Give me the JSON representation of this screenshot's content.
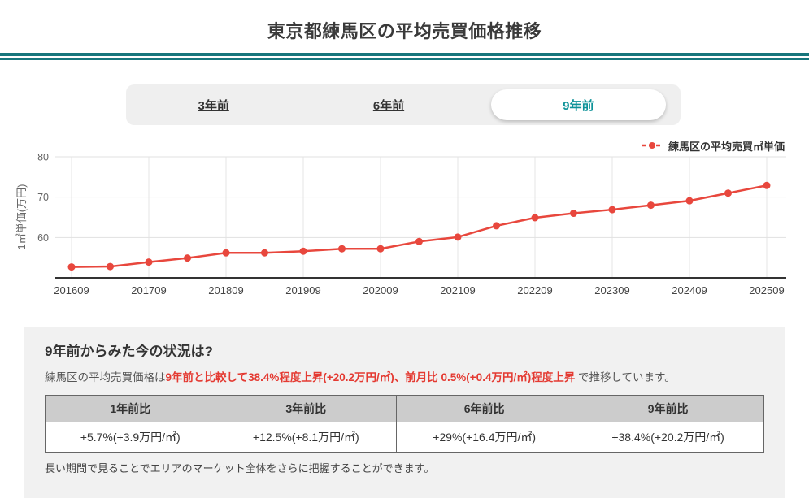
{
  "page": {
    "title": "東京都練馬区の平均売買価格推移"
  },
  "tabs": {
    "items": [
      {
        "label": "3年前",
        "active": false
      },
      {
        "label": "6年前",
        "active": false
      },
      {
        "label": "9年前",
        "active": true
      }
    ]
  },
  "legend": {
    "label": "練馬区の平均売買㎡単価"
  },
  "chart_data": {
    "type": "line",
    "title": "",
    "xlabel": "",
    "ylabel": "1㎡単価(万円)",
    "ylim": [
      50,
      80
    ],
    "yticks": [
      60,
      70,
      80
    ],
    "tick_every": 2,
    "grid": true,
    "legend_position": "top-right",
    "x": [
      "201609",
      "201703",
      "201709",
      "201803",
      "201809",
      "201903",
      "201909",
      "202003",
      "202009",
      "202103",
      "202109",
      "202203",
      "202209",
      "202303",
      "202309",
      "202403",
      "202409",
      "202503",
      "202509"
    ],
    "series": [
      {
        "name": "練馬区の平均売買㎡単価",
        "color": "#e8473d",
        "values": [
          52.7,
          52.8,
          53.9,
          54.9,
          56.2,
          56.2,
          56.6,
          57.2,
          57.2,
          59.0,
          60.1,
          62.9,
          64.9,
          66.0,
          66.9,
          68.0,
          69.1,
          71.0,
          72.9
        ]
      }
    ]
  },
  "summary": {
    "heading": "9年前からみた今の状況は?",
    "lead_prefix": "練馬区の平均売買価格は",
    "lead_highlight": "9年前と比較して38.4%程度上昇(+20.2万円/㎡)、前月比 0.5%(+0.4万円/㎡)程度上昇",
    "lead_suffix": " で推移しています。",
    "table": {
      "headers": [
        "1年前比",
        "3年前比",
        "6年前比",
        "9年前比"
      ],
      "values": [
        "+5.7%(+3.9万円/㎡)",
        "+12.5%(+8.1万円/㎡)",
        "+29%(+16.4万円/㎡)",
        "+38.4%(+20.2万円/㎡)"
      ]
    },
    "footnote": "長い期間で見ることでエリアのマーケット全体をさらに把握することができます。"
  },
  "colors": {
    "accent_teal": "#0d9298",
    "header_rule_teal": "#17767c",
    "series_red": "#e8473d",
    "highlight_red": "#e43a32",
    "panel_bg": "#f1f1f1",
    "table_header_bg": "#cccccc"
  }
}
